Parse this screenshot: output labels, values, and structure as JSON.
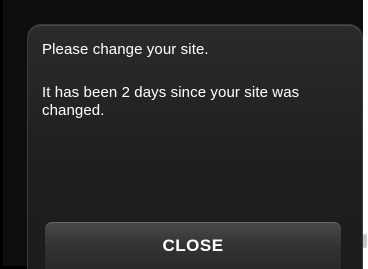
{
  "dialog": {
    "message_line_1": "Please change your site.",
    "message_line_2": "It has been 2 days since your site was changed.",
    "close_label": "CLOSE"
  }
}
